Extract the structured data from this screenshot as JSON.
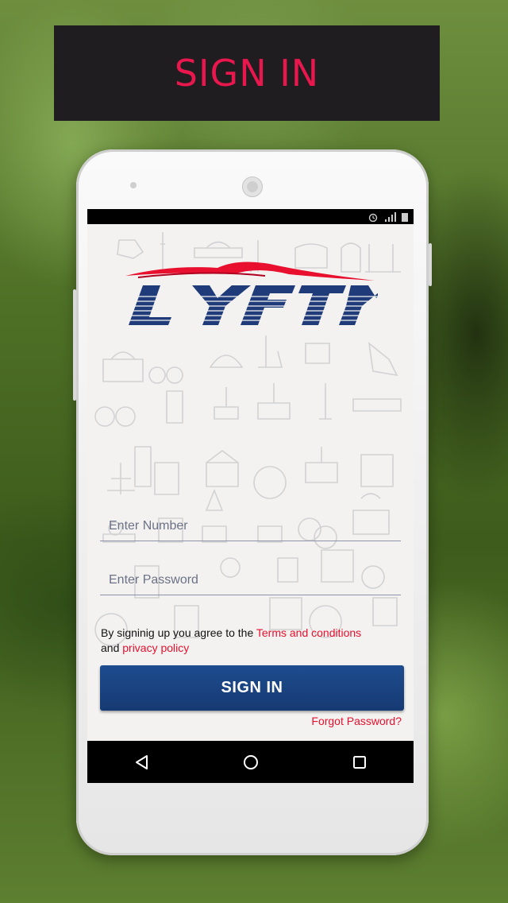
{
  "banner": {
    "title": "SIGN IN"
  },
  "logo": {
    "text": "LYFTY",
    "colors": {
      "swoosh": "#e8102e",
      "letters": "#1f3b7a"
    }
  },
  "statusbar": {
    "icons": [
      "alarm-icon",
      "signal-icon",
      "battery-icon"
    ]
  },
  "form": {
    "number_placeholder": "Enter Number",
    "password_placeholder": "Enter Password",
    "terms_prefix": "By signinig up you agree to the ",
    "terms_link": "Terms and conditions",
    "terms_and": "and ",
    "privacy_link": "privacy policy",
    "signin_label": "SIGN IN",
    "forgot_label": "Forgot Password?"
  },
  "navbar": {
    "icons": [
      "back-icon",
      "home-icon",
      "recents-icon"
    ]
  },
  "colors": {
    "accent": "#e8174d",
    "button": "#1e4c8e",
    "link": "#e8102e",
    "banner_bg": "#1f1d20"
  }
}
